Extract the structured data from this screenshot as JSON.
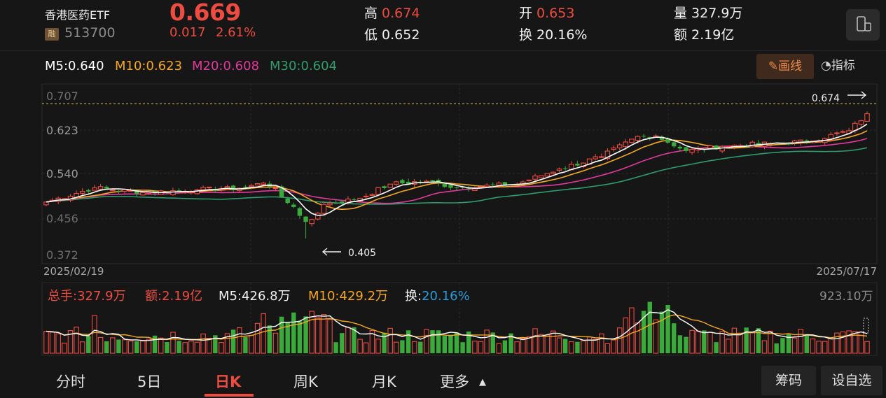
{
  "header": {
    "name": "香港医药ETF",
    "badge": "融",
    "code": "513700",
    "price": "0.669",
    "change": "0.017",
    "change_pct": "2.61%",
    "high_label": "高",
    "high": "0.674",
    "low_label": "低",
    "low": "0.652",
    "open_label": "开",
    "open": "0.653",
    "turnover_label": "换",
    "turnover": "20.16%",
    "volume_label": "量",
    "volume": "327.9万",
    "amount_label": "额",
    "amount": "2.19亿"
  },
  "ma": {
    "m5": "M5:0.640",
    "m10": "M10:0.623",
    "m20": "M20:0.608",
    "m30": "M30:0.604"
  },
  "toolbar": {
    "draw": "画线",
    "indicator": "指标"
  },
  "kline": {
    "ticks": [
      "0.707",
      "0.623",
      "0.540",
      "0.456",
      "0.372"
    ],
    "date_start": "2025/02/19",
    "date_end": "2025/07/17",
    "high_marker": "0.674",
    "low_marker": "0.405"
  },
  "volume_panel": {
    "total": "总手:327.9万",
    "amount": "额:2.19亿",
    "m5": "M5:426.8万",
    "m10": "M10:429.2万",
    "turnover_label": "换:",
    "turnover": "20.16%",
    "max": "923.10万"
  },
  "tabs": [
    "分时",
    "5日",
    "日K",
    "周K",
    "月K",
    "更多"
  ],
  "active_tab": "日K",
  "side_buttons": [
    "筹码",
    "设自选"
  ],
  "colors": {
    "up": "#ee4c41",
    "down": "#3aab3a",
    "ma5": "#ffffff",
    "ma10": "#f5a623",
    "ma20": "#e0399b",
    "ma30": "#2f9c6e",
    "background": "#161616"
  },
  "chart_data": {
    "type": "candlestick",
    "ylim": [
      0.372,
      0.707
    ],
    "high": 0.674,
    "low": 0.405,
    "close_start": 0.481,
    "close_end": 0.669,
    "anchors": [
      [
        0,
        0.482
      ],
      [
        8,
        0.512
      ],
      [
        16,
        0.502
      ],
      [
        25,
        0.508
      ],
      [
        32,
        0.511
      ],
      [
        36,
        0.522
      ],
      [
        38,
        0.512
      ],
      [
        40,
        0.48
      ],
      [
        43,
        0.44
      ],
      [
        44,
        0.445
      ],
      [
        46,
        0.477
      ],
      [
        52,
        0.49
      ],
      [
        57,
        0.52
      ],
      [
        63,
        0.526
      ],
      [
        68,
        0.512
      ],
      [
        78,
        0.52
      ],
      [
        85,
        0.552
      ],
      [
        92,
        0.578
      ],
      [
        98,
        0.621
      ],
      [
        101,
        0.622
      ],
      [
        106,
        0.59
      ],
      [
        112,
        0.6
      ],
      [
        120,
        0.606
      ],
      [
        126,
        0.61
      ],
      [
        133,
        0.633
      ],
      [
        136,
        0.669
      ]
    ],
    "count": 137
  }
}
